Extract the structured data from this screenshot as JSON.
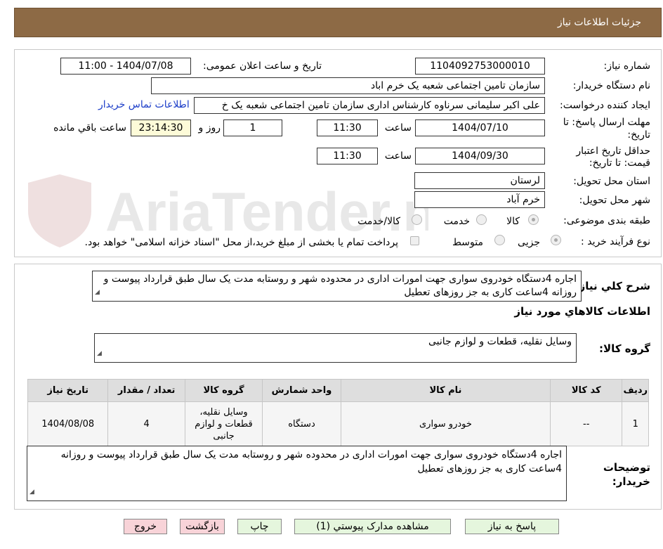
{
  "header": {
    "title": "جزئیات اطلاعات نیاز"
  },
  "watermark": {
    "text": "AriaTender.neT"
  },
  "form": {
    "need_number_label": "شماره نیاز:",
    "need_number": "1104092753000010",
    "announce_label": "تاریخ و ساعت اعلان عمومی:",
    "announce_value": "1404/07/08 - 11:00",
    "buyer_org_label": "نام دستگاه خریدار:",
    "buyer_org": "سازمان تامین اجتماعی شعبه یک خرم اباد",
    "creator_label": "ایجاد کننده درخواست:",
    "creator": "علی اکبر سلیمانی سرناوه کارشناس اداری سازمان تامین اجتماعی شعبه یک خ",
    "contact_link": "اطلاعات تماس خریدار",
    "deadline_label_1": "مهلت ارسال پاسخ: تا",
    "deadline_label_2": "تاریخ:",
    "deadline_date": "1404/07/10",
    "time_label": "ساعت",
    "deadline_time": "11:30",
    "days": "1",
    "days_label": "روز و",
    "remaining_time": "23:14:30",
    "remaining_label": "ساعت باقي مانده",
    "validity_label_1": "حداقل تاریخ اعتبار",
    "validity_label_2": "قیمت: تا تاریخ:",
    "validity_date": "1404/09/30",
    "validity_time_label": "ساعت",
    "validity_time": "11:30",
    "province_label": "استان محل تحویل:",
    "province": "لرستان",
    "city_label": "شهر محل تحویل:",
    "city": "خرم آباد",
    "category_label": "طبقه بندی موضوعی:",
    "category_options": [
      "کالا",
      "خدمت",
      "کالا/خدمت"
    ],
    "category_selected": "کالا",
    "process_label": "نوع فرآیند خرید :",
    "process_options": [
      "جزیی",
      "متوسط"
    ],
    "process_selected": "جزیی",
    "payment_note": "پرداخت تمام یا بخشی از مبلغ خرید،از محل \"اسناد خزانه اسلامی\" خواهد بود."
  },
  "summary": {
    "label": "شرح کلي نياز:",
    "text": "اجاره 4دستگاه خودروی سواری جهت امورات اداری در محدوده شهر و روستابه مدت یک سال طبق قرارداد پیوست و روزانه 4ساعت کاری به جز روزهای تعطیل"
  },
  "goods": {
    "section_title": "اطلاعات کالاهاي مورد نياز",
    "group_label": "گروه کالا:",
    "group_value": "وسایل نقلیه، قطعات و لوازم جانبی",
    "columns": [
      "ردیف",
      "کد کالا",
      "نام کالا",
      "واحد شمارش",
      "گروه کالا",
      "تعداد / مقدار",
      "تاریخ نیاز"
    ],
    "rows": [
      [
        "1",
        "--",
        "خودرو سواری",
        "دستگاه",
        "وسایل نقلیه، قطعات و لوازم جانبی",
        "4",
        "1404/08/08"
      ]
    ]
  },
  "notes": {
    "label_1": "توضیحات",
    "label_2": "خریدار:",
    "text": "اجاره 4دستگاه خودروی سواری جهت امورات اداری در محدوده شهر و روستابه مدت یک سال طبق قرارداد پیوست و روزانه 4ساعت کاری به جز روزهای تعطیل"
  },
  "buttons": {
    "reply": "پاسخ به نیاز",
    "view_docs": "مشاهده مدارک پیوستي (1)",
    "print": "چاپ",
    "back": "بازگشت",
    "exit": "خروج"
  },
  "colors": {
    "header_bg": "#8d6a45",
    "link": "#1a3cc8",
    "button_green": "#e5f6dd",
    "button_pink": "#f8d3d8",
    "remaining_bg": "#fdfbd8"
  }
}
